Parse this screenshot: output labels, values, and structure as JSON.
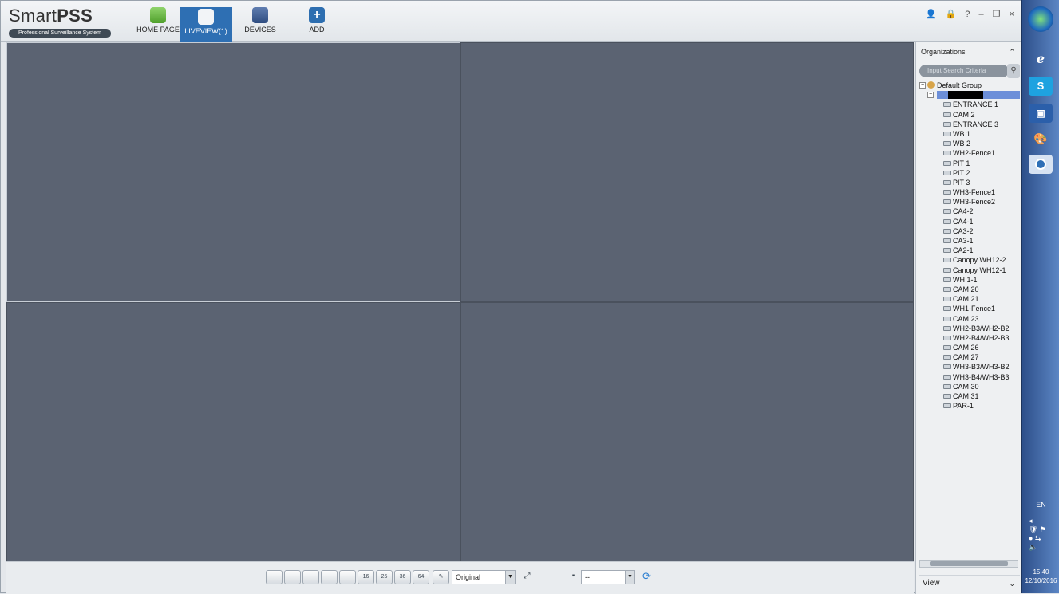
{
  "app": {
    "brand_name_light": "Smart",
    "brand_name_bold": "PSS",
    "brand_tagline": "Professional Surveillance System"
  },
  "nav": {
    "tabs": [
      {
        "label": "HOME PAGE",
        "icon": "home-icon"
      },
      {
        "label": "LIVEVIEW(1)",
        "icon": "liveview-icon",
        "active": true
      },
      {
        "label": "DEVICES",
        "icon": "devices-icon"
      },
      {
        "label": "ADD",
        "icon": "add-icon"
      }
    ]
  },
  "window_controls": [
    "person-icon",
    "lock-icon",
    "help-icon",
    "minimize-icon",
    "restore-icon",
    "close-icon"
  ],
  "toolbar": {
    "layout_buttons": [
      "1",
      "4",
      "6",
      "8",
      "9",
      "16",
      "25",
      "36",
      "64"
    ],
    "stream_select": "Original",
    "preset_select": "--"
  },
  "panel": {
    "title": "Organizations",
    "search_placeholder": "Input Search Criteria",
    "group": "Default Group",
    "channels": [
      "ENTRANCE 1",
      "CAM 2",
      "ENTRANCE 3",
      "WB 1",
      "WB 2",
      "WH2-Fence1",
      "PIT 1",
      "PIT 2",
      "PIT 3",
      "WH3-Fence1",
      "WH3-Fence2",
      "CA4-2",
      "CA4-1",
      "CA3-2",
      "CA3-1",
      "CA2-1",
      "Canopy WH12-2",
      "Canopy WH12-1",
      "WH 1-1",
      "CAM 20",
      "CAM 21",
      "WH1-Fence1",
      "CAM 23",
      "WH2-B3/WH2-B2",
      "WH2-B4/WH2-B3",
      "CAM 26",
      "CAM 27",
      "WH3-B3/WH3-B2",
      "WH3-B4/WH3-B3",
      "CAM 30",
      "CAM 31",
      "PAR-1"
    ],
    "view_label": "View"
  },
  "taskbar": {
    "language": "EN",
    "time": "15:40",
    "date": "12/10/2016"
  }
}
